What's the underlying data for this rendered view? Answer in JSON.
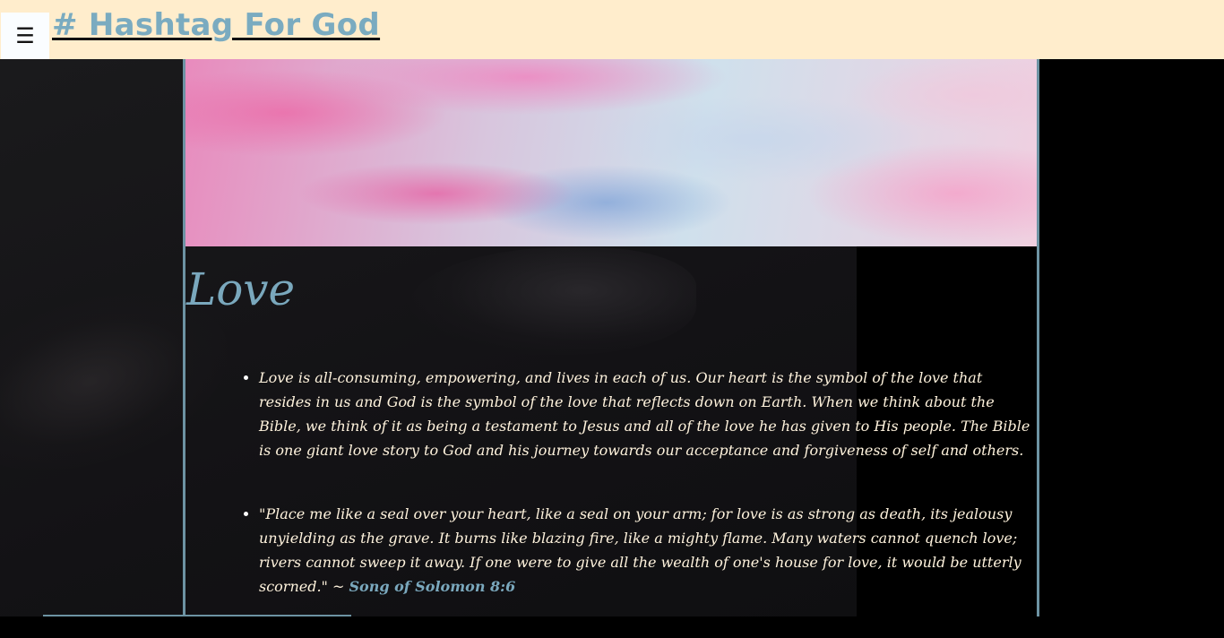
{
  "header": {
    "menu_icon": "☰",
    "title": "# Hashtag For God"
  },
  "colors": {
    "header_bg": "#ffedcc",
    "title_color": "#7aabc0",
    "accent": "#7aa8bd",
    "text": "#fff3dd",
    "border": "#6d93a3"
  },
  "main": {
    "heading": "Love",
    "items": [
      {
        "text": "Love is all-consuming, empowering, and lives in each of us. Our heart is the symbol of the love that resides in us and God is the symbol of the love that reflects down on Earth. When we think about the Bible, we think of it as being a testament to Jesus and all of the love he has given to His people. The Bible is one giant love story to God and his journey towards our acceptance and forgiveness of self and others."
      },
      {
        "text": "\"Place me like a seal over your heart, like a seal on your arm; for love is as strong as death, its jealousy unyielding as the grave. It burns like blazing fire, like a mighty flame. Many waters cannot quench love; rivers cannot sweep it away. If one were to give all the wealth of one's house for love, it would be utterly scorned.\" ~ ",
        "citation": "Song of Solomon 8:6"
      }
    ]
  },
  "images": {
    "banner": "pink-blue marble texture banner",
    "background": "dark photo of hands"
  }
}
